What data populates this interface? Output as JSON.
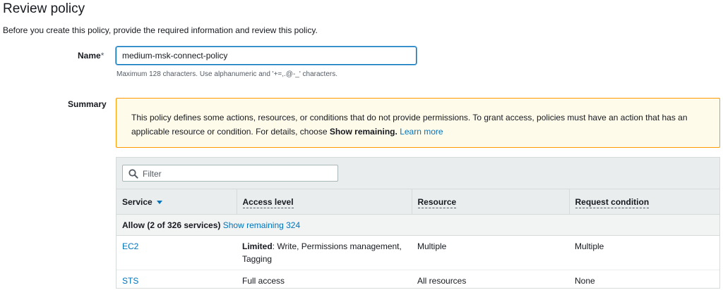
{
  "header": {
    "title": "Review policy",
    "description": "Before you create this policy, provide the required information and review this policy."
  },
  "name_field": {
    "label": "Name",
    "required_marker": "*",
    "value": "medium-msk-connect-policy",
    "hint": "Maximum 128 characters. Use alphanumeric and '+=,.@-_' characters."
  },
  "summary": {
    "label": "Summary",
    "warning": {
      "text": "This policy defines some actions, resources, or conditions that do not provide permissions. To grant access, policies must have an action that has an applicable resource or condition. For details, choose ",
      "bold": "Show remaining.",
      "link": "Learn more"
    },
    "filter": {
      "placeholder": "Filter"
    },
    "columns": [
      "Service",
      "Access level",
      "Resource",
      "Request condition"
    ],
    "group": {
      "label": "Allow (2 of 326 services)",
      "link": "Show remaining 324"
    },
    "rows": [
      {
        "service": "EC2",
        "access_bold": "Limited",
        "access_rest": ": Write, Permissions management, Tagging",
        "resource": "Multiple",
        "condition": "Multiple"
      },
      {
        "service": "STS",
        "access_bold": "",
        "access_rest": "Full access",
        "resource": "All resources",
        "condition": "None"
      }
    ]
  },
  "colors": {
    "link": "#0073bb",
    "warning_border": "#ff9900",
    "warning_bg": "#fffbea"
  }
}
